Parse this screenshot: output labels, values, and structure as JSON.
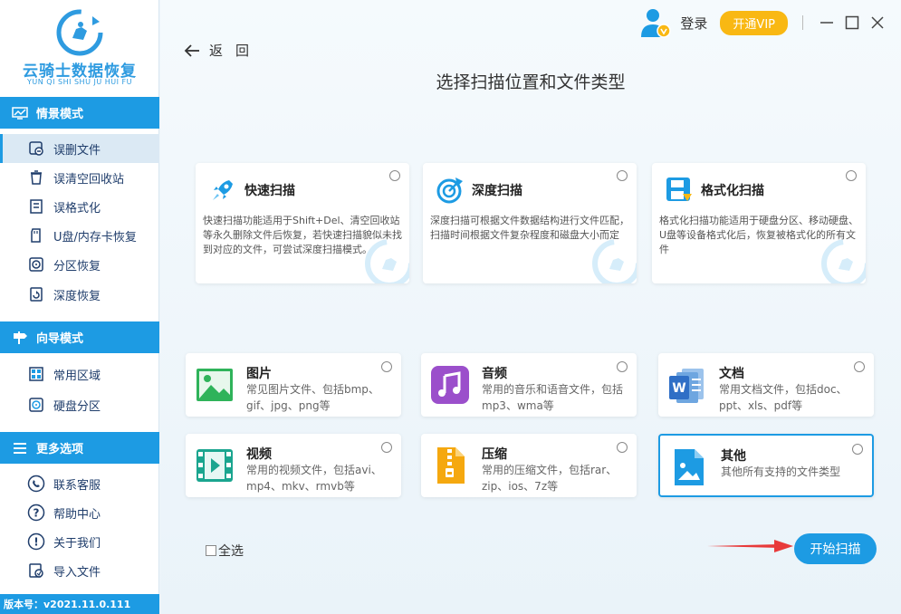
{
  "app": {
    "name": "云骑士数据恢复",
    "pinyin": "YUN QI SHI SHU JU HUI FU",
    "version": "版本号：v2021.11.0.111"
  },
  "sidebar": {
    "sections": [
      {
        "label": "情景模式",
        "items": [
          "误删文件",
          "误清空回收站",
          "误格式化",
          "U盘/内存卡恢复",
          "分区恢复",
          "深度恢复"
        ]
      },
      {
        "label": "向导模式",
        "items": [
          "常用区域",
          "硬盘分区"
        ]
      },
      {
        "label": "更多选项",
        "items": [
          "联系客服",
          "帮助中心",
          "关于我们",
          "导入文件"
        ]
      }
    ],
    "active_item": "误删文件"
  },
  "header": {
    "back_label": "返回",
    "login_label": "登录",
    "vip_label": "开通VIP",
    "title": "选择扫描位置和文件类型"
  },
  "scan_modes": [
    {
      "name": "快速扫描",
      "icon": "rocket-icon",
      "desc": "快速扫描功能适用于Shift+Del、清空回收站等永久删除文件后恢复，若快速扫描貌似未找到对应的文件，可尝试深度扫描模式。"
    },
    {
      "name": "深度扫描",
      "icon": "deep-scan-icon",
      "desc": "深度扫描可根据文件数据结构进行文件匹配，扫描时间根据文件复杂程度和磁盘大小而定"
    },
    {
      "name": "格式化扫描",
      "icon": "format-scan-icon",
      "desc": "格式化扫描功能适用于硬盘分区、移动硬盘、U盘等设备格式化后，恢复被格式化的所有文件"
    }
  ],
  "file_types": [
    {
      "name": "图片",
      "icon": "image-icon",
      "desc": "常见图片文件、包括bmp、gif、jpg、png等",
      "selected": false
    },
    {
      "name": "音频",
      "icon": "music-icon",
      "desc": "常用的音乐和语音文件，包括mp3、wma等",
      "selected": false
    },
    {
      "name": "文档",
      "icon": "document-icon",
      "desc": "常用文档文件，包括doc、ppt、xls、pdf等",
      "selected": false
    },
    {
      "name": "视频",
      "icon": "video-icon",
      "desc": "常用的视频文件，包括avi、mp4、mkv、rmvb等",
      "selected": false
    },
    {
      "name": "压缩",
      "icon": "zip-icon",
      "desc": "常用的压缩文件，包括rar、zip、ios、7z等",
      "selected": false
    },
    {
      "name": "其他",
      "icon": "other-file-icon",
      "desc": "其他所有支持的文件类型",
      "selected": true
    }
  ],
  "footer": {
    "select_all_label": "全选",
    "start_label": "开始扫描"
  },
  "colors": {
    "accent": "#1d9be3",
    "vip": "#f9b813",
    "arrow": "#e83a3a"
  }
}
